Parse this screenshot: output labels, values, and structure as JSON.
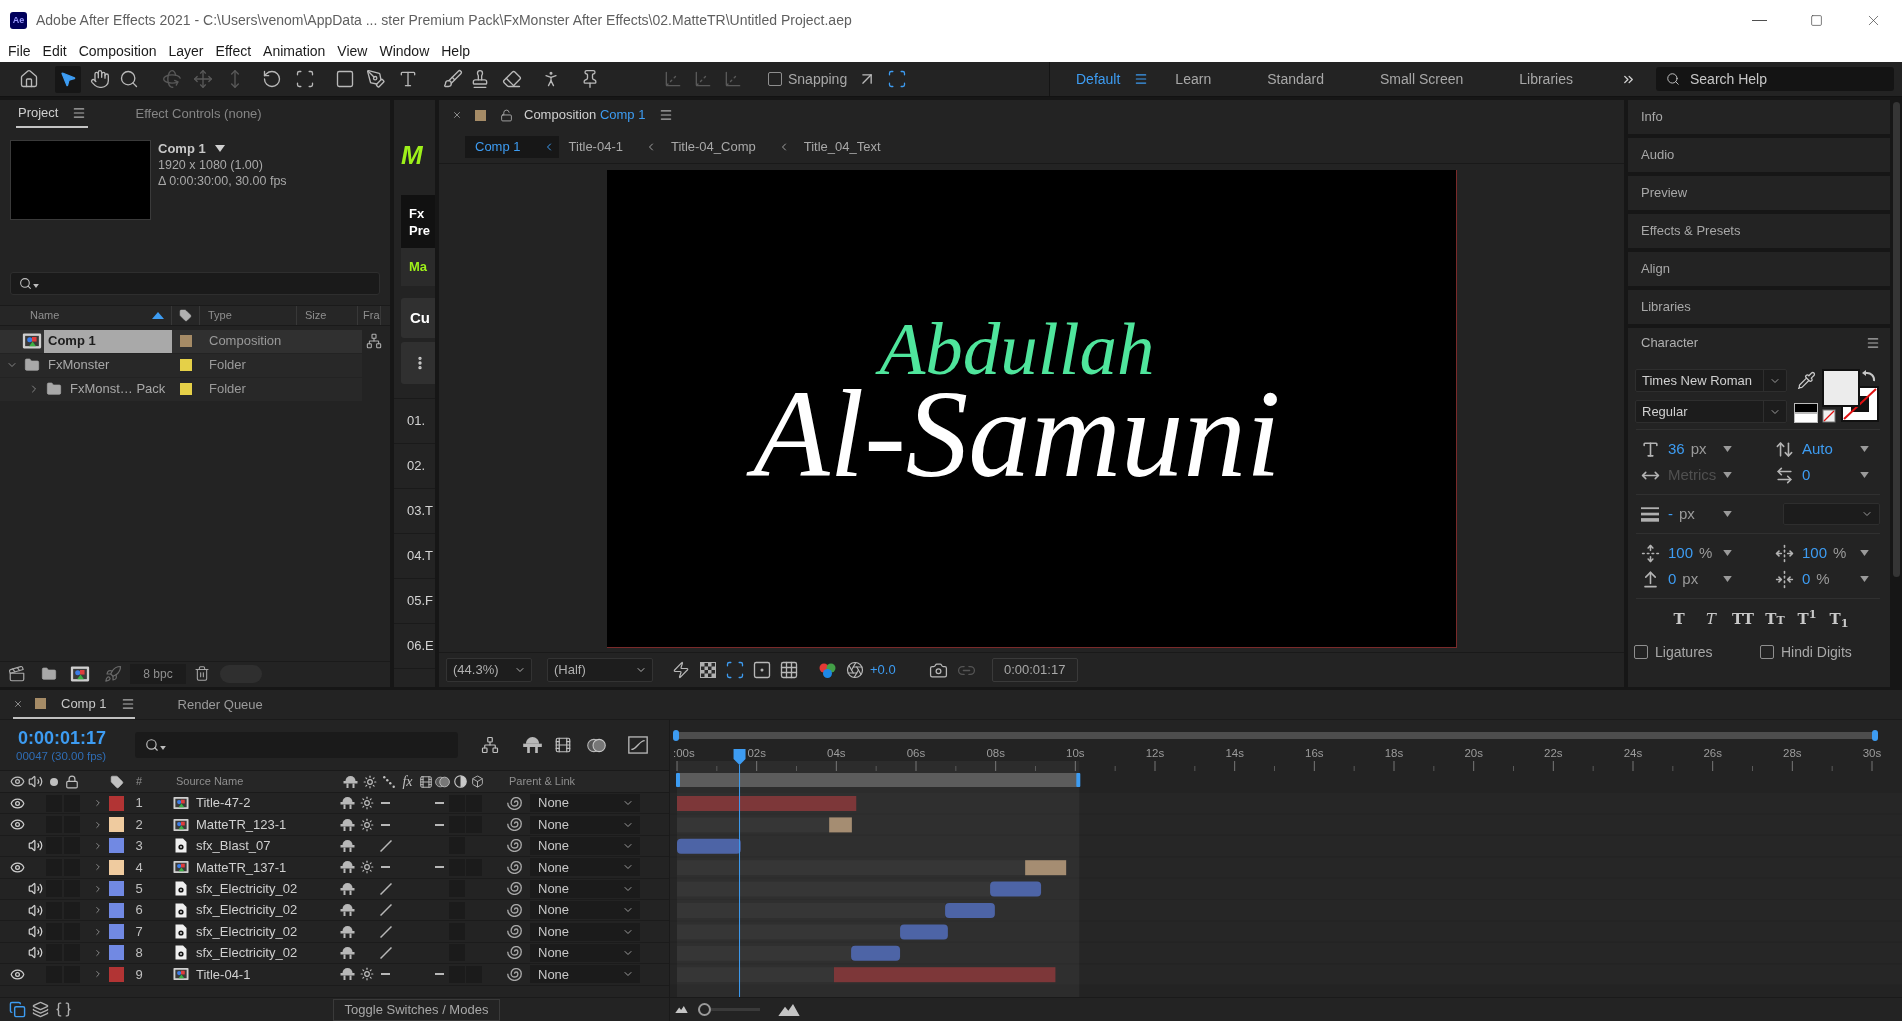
{
  "window": {
    "app_badge": "Ae",
    "title": "Adobe After Effects 2021 - C:\\Users\\venom\\AppData ... ster Premium Pack\\FxMonster After Effects\\02.MatteTR\\Untitled Project.aep"
  },
  "menu": [
    "File",
    "Edit",
    "Composition",
    "Layer",
    "Effect",
    "Animation",
    "View",
    "Window",
    "Help"
  ],
  "toolbar": {
    "snapping": {
      "label": "Snapping",
      "checked": false
    },
    "workspaces": [
      {
        "label": "Default",
        "selected": true
      },
      {
        "label": "Learn",
        "selected": false
      },
      {
        "label": "Standard",
        "selected": false
      },
      {
        "label": "Small Screen",
        "selected": false
      },
      {
        "label": "Libraries",
        "selected": false
      }
    ],
    "search": {
      "placeholder": "Search Help"
    }
  },
  "project_panel": {
    "tabs": [
      {
        "label": "Project",
        "selected": true
      },
      {
        "label": "Effect Controls (none)",
        "selected": false
      }
    ],
    "preview": {
      "name": "Comp 1",
      "dimensions": "1920 x 1080 (1.00)",
      "duration": "Δ 0:00:30:00, 30.00 fps"
    },
    "columns": [
      {
        "label": "Name",
        "sorted": true
      },
      {
        "label": "Type",
        "sorted": false
      },
      {
        "label": "Size",
        "sorted": false
      },
      {
        "label": "Fra",
        "sorted": false
      }
    ],
    "items": [
      {
        "name": "Comp 1",
        "kind": "composition",
        "type": "Composition",
        "color": "#a58b66",
        "selected": true
      },
      {
        "name": "FxMonster",
        "kind": "folder",
        "type": "Folder",
        "color": "#e5d048",
        "selected": false,
        "expanded": true,
        "children": [
          {
            "name": "FxMonst… Pack",
            "kind": "folder",
            "type": "Folder",
            "color": "#e5d048",
            "selected": false,
            "expanded": false
          }
        ]
      }
    ],
    "bit_depth": "8 bpc"
  },
  "fxmonster_panel": {
    "logo": "M",
    "cards": [
      {
        "kind": "title",
        "lines": [
          "Fx",
          "Pre"
        ]
      },
      {
        "kind": "accent",
        "lines": [
          "Ma"
        ]
      },
      {
        "kind": "button",
        "lines": [
          "Cu"
        ]
      },
      {
        "kind": "more"
      }
    ],
    "presets": [
      "01.",
      "02.",
      "03.T",
      "04.T",
      "05.F",
      "06.E"
    ]
  },
  "composition_panel": {
    "tab": {
      "prefix": "Composition",
      "name": "Comp 1"
    },
    "breadcrumbs": [
      {
        "label": "Comp 1",
        "selected": true
      },
      {
        "label": "Title-04-1",
        "selected": false
      },
      {
        "label": "Title-04_Comp",
        "selected": false
      },
      {
        "label": "Title_04_Text",
        "selected": false
      }
    ],
    "frame_text": [
      {
        "text": "Abdullah",
        "color": "#4fe59c"
      },
      {
        "text": "Al-Samuni",
        "color": "#ffffff"
      }
    ],
    "magnification": "(44.3%)",
    "resolution": "(Half)",
    "exposure": "+0.0",
    "current_time": "0:00:01:17"
  },
  "side_panels": [
    "Info",
    "Audio",
    "Preview",
    "Effects & Presets",
    "Align",
    "Libraries"
  ],
  "character_panel": {
    "title": "Character",
    "font": "Times New Roman",
    "style": "Regular",
    "field_groups": [
      [
        {
          "kind": "font_size",
          "value": "36",
          "unit": "px",
          "disabled": false
        },
        {
          "kind": "leading",
          "value": "Auto",
          "disabled": false
        },
        {
          "kind": "kerning",
          "value": "Metrics",
          "disabled": true
        },
        {
          "kind": "tracking",
          "value": "0",
          "disabled": false
        }
      ],
      [
        {
          "kind": "stroke_width",
          "value": "-",
          "unit": "px",
          "disabled": false
        }
      ],
      [
        {
          "kind": "vertical_scale",
          "value": "100",
          "unit": "%",
          "disabled": false
        },
        {
          "kind": "horizontal_scale",
          "value": "100",
          "unit": "%",
          "disabled": false
        },
        {
          "kind": "baseline_shift",
          "value": "0",
          "unit": "px",
          "disabled": false
        },
        {
          "kind": "tsume",
          "value": "0",
          "unit": "%",
          "disabled": false
        }
      ]
    ],
    "style_buttons": [
      {
        "label": "T",
        "kind": "bold"
      },
      {
        "label": "T",
        "kind": "italic"
      },
      {
        "label": "TT",
        "kind": "all_caps"
      },
      {
        "label": "TT",
        "kind": "small_caps"
      },
      {
        "label": "T$^{1}$",
        "kind": "superscript"
      },
      {
        "label": "T$_{1}$",
        "kind": "subscript"
      }
    ],
    "options": [
      {
        "label": "Ligatures",
        "checked": false
      },
      {
        "label": "Hindi Digits",
        "checked": false
      }
    ]
  },
  "timeline": {
    "tabs": [
      {
        "label": "Comp 1",
        "kind": "composition",
        "selected": true
      },
      {
        "label": "Render Queue",
        "kind": "queue",
        "selected": false
      }
    ],
    "current_time": "0:00:01:17",
    "frame_info": "00047 (30.00 fps)",
    "columns": {
      "number": "#",
      "source": "Source Name",
      "effects": "fx",
      "parent": "Parent & Link"
    },
    "layers": [
      {
        "number": "1",
        "name": "Title-47-2",
        "kind": "comp",
        "color": "#b23434",
        "enabled": true,
        "parent": "None"
      },
      {
        "number": "2",
        "name": "MatteTR_123-1",
        "kind": "comp",
        "color": "#efcb9f",
        "enabled": true,
        "parent": "None"
      },
      {
        "number": "3",
        "name": "sfx_Blast_07",
        "kind": "audio",
        "color": "#7189e3",
        "enabled": true,
        "parent": "None"
      },
      {
        "number": "4",
        "name": "MatteTR_137-1",
        "kind": "comp",
        "color": "#efcb9f",
        "enabled": true,
        "parent": "None"
      },
      {
        "number": "5",
        "name": "sfx_Electricity_02",
        "kind": "audio",
        "color": "#7189e3",
        "enabled": true,
        "parent": "None"
      },
      {
        "number": "6",
        "name": "sfx_Electricity_02",
        "kind": "audio",
        "color": "#7189e3",
        "enabled": true,
        "parent": "None"
      },
      {
        "number": "7",
        "name": "sfx_Electricity_02",
        "kind": "audio",
        "color": "#7189e3",
        "enabled": true,
        "parent": "None"
      },
      {
        "number": "8",
        "name": "sfx_Electricity_02",
        "kind": "audio",
        "color": "#7189e3",
        "enabled": true,
        "parent": "None"
      },
      {
        "number": "9",
        "name": "Title-04-1",
        "kind": "comp",
        "color": "#b23434",
        "enabled": true,
        "parent": "None"
      }
    ],
    "toggle_label": "Toggle Switches / Modes",
    "zoom_slider": {
      "level": 0.1
    },
    "chart_data": {
      "type": "bar",
      "orientation": "horizontal",
      "stacked": true,
      "series": [
        {
          "color": "#363636",
          "values": [
            0,
            3.82,
            0,
            8.74,
            7.86,
            6.73,
            5.6,
            4.37,
            3.94
          ]
        },
        {
          "colors": [
            "#7d3739",
            "#a58d72",
            "#4d64a6",
            "#a58d72",
            "#4d64a6",
            "#4d64a6",
            "#4d64a6",
            "#4d64a6",
            "#7d3739"
          ],
          "values": [
            4.5,
            0.57,
            1.6,
            1.03,
            1.28,
            1.25,
            1.2,
            1.23,
            5.56
          ]
        }
      ],
      "xlim": [
        0,
        30
      ],
      "xticks": [
        {
          "value": 0,
          "label": ":00s"
        },
        {
          "value": 2,
          "label": "02s"
        },
        {
          "value": 4,
          "label": "04s"
        },
        {
          "value": 6,
          "label": "06s"
        },
        {
          "value": 8,
          "label": "08s"
        },
        {
          "value": 10,
          "label": "10s"
        },
        {
          "value": 12,
          "label": "12s"
        },
        {
          "value": 14,
          "label": "14s"
        },
        {
          "value": 16,
          "label": "16s"
        },
        {
          "value": 18,
          "label": "18s"
        },
        {
          "value": 20,
          "label": "20s"
        },
        {
          "value": 22,
          "label": "22s"
        },
        {
          "value": 24,
          "label": "24s"
        },
        {
          "value": 26,
          "label": "26s"
        },
        {
          "value": 28,
          "label": "28s"
        },
        {
          "value": 30,
          "label": "30s"
        }
      ],
      "bands": [
        {
          "axis": "x",
          "from": 0,
          "to": 10.1
        }
      ],
      "ref_lines": [
        {
          "axis": "x",
          "value": 1.57
        }
      ]
    }
  }
}
